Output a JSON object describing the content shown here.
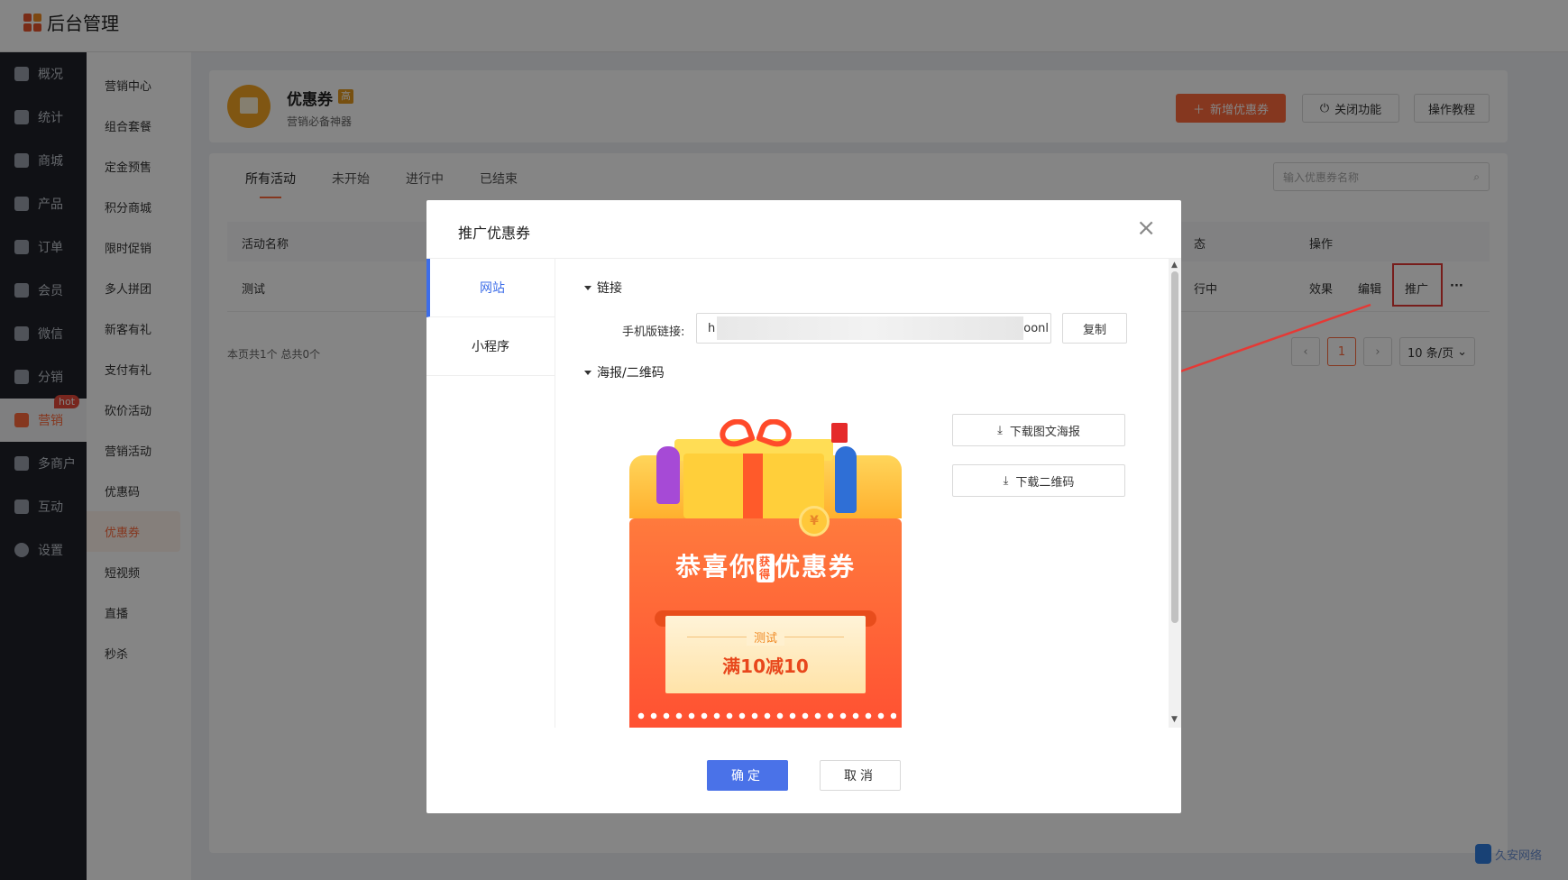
{
  "app": {
    "title": "后台管理"
  },
  "sidebar": {
    "items": [
      {
        "label": "概况",
        "icon": "dashboard-icon"
      },
      {
        "label": "统计",
        "icon": "stats-icon"
      },
      {
        "label": "商城",
        "icon": "shop-icon"
      },
      {
        "label": "产品",
        "icon": "product-icon"
      },
      {
        "label": "订单",
        "icon": "order-icon"
      },
      {
        "label": "会员",
        "icon": "member-icon"
      },
      {
        "label": "微信",
        "icon": "wechat-icon"
      },
      {
        "label": "分销",
        "icon": "distribution-icon"
      },
      {
        "label": "营销",
        "icon": "flag-icon",
        "badge": "hot",
        "active": true
      },
      {
        "label": "多商户",
        "icon": "merchant-icon"
      },
      {
        "label": "互动",
        "icon": "interact-icon"
      },
      {
        "label": "设置",
        "icon": "gear-icon"
      }
    ]
  },
  "subnav": {
    "items": [
      "营销中心",
      "组合套餐",
      "定金预售",
      "积分商城",
      "限时促销",
      "多人拼团",
      "新客有礼",
      "支付有礼",
      "砍价活动",
      "营销活动",
      "优惠码",
      "优惠券",
      "短视频",
      "直播",
      "秒杀"
    ],
    "active": "优惠券"
  },
  "header": {
    "title": "优惠券",
    "badge": "高",
    "subtitle": "营销必备神器",
    "new_button": "新增优惠券",
    "off_button": "关闭功能",
    "tutorial_button": "操作教程"
  },
  "tabs": [
    "所有活动",
    "未开始",
    "进行中",
    "已结束"
  ],
  "search": {
    "placeholder": "输入优惠券名称"
  },
  "table": {
    "columns": {
      "name": "活动名称",
      "status": "态",
      "action": "操作"
    },
    "rows": [
      {
        "name": "测试",
        "status": "行中",
        "actions": [
          "效果",
          "编辑",
          "推广",
          "···"
        ]
      }
    ]
  },
  "pagination": {
    "info": "本页共1个 总共0个",
    "current": "1",
    "page_size": "10 条/页"
  },
  "modal": {
    "title": "推广优惠券",
    "tabs": [
      "网站",
      "小程序"
    ],
    "link_section": "链接",
    "link_label": "手机版链接:",
    "link_start": "h",
    "link_end": "oonl",
    "copy_button": "复制",
    "poster_section": "海报/二维码",
    "download_poster": "下载图文海报",
    "download_qrcode": "下载二维码",
    "poster": {
      "headline_a": "恭喜你",
      "headline_get": "获得",
      "headline_b": "优惠券",
      "coupon_name": "测试",
      "coupon_value": "满10减10",
      "coin": "¥"
    },
    "ok_button": "确定",
    "cancel_button": "取消"
  },
  "watermark": "久安网络",
  "colors": {
    "accent": "#ff6a3d",
    "primary": "#4a72e8",
    "highlight": "#e53935"
  }
}
